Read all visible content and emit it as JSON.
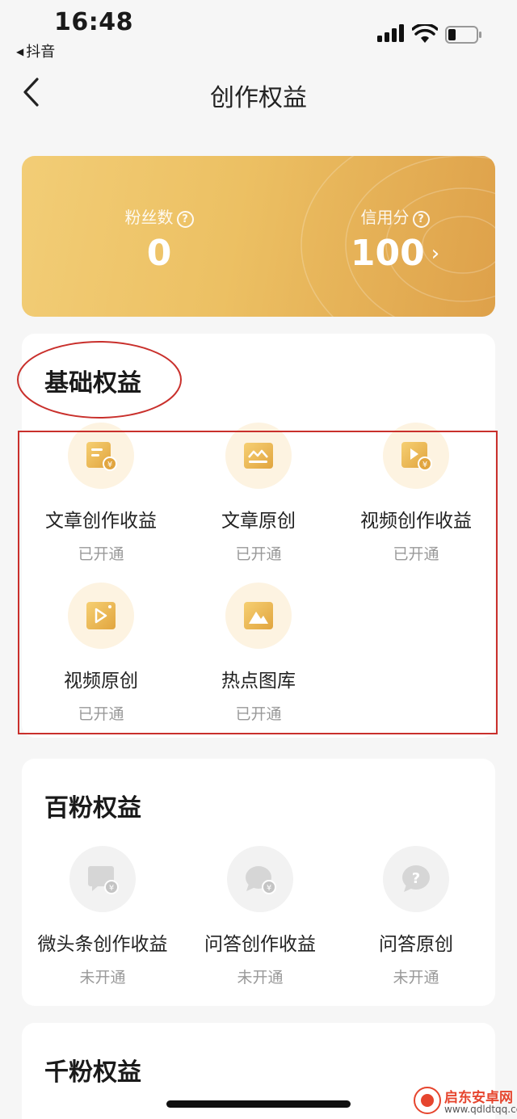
{
  "status": {
    "time": "16:48",
    "back_app": "抖音",
    "back_arrow": "◀"
  },
  "nav": {
    "title": "创作权益"
  },
  "stats": {
    "fans_label": "粉丝数",
    "fans_value": "0",
    "credit_label": "信用分",
    "credit_value": "100",
    "help_glyph": "?",
    "arrow_glyph": "›"
  },
  "sections": {
    "basic": {
      "title": "基础权益",
      "items": [
        {
          "name": "文章创作收益",
          "status": "已开通",
          "icon": "article-income-icon"
        },
        {
          "name": "文章原创",
          "status": "已开通",
          "icon": "article-original-icon"
        },
        {
          "name": "视频创作收益",
          "status": "已开通",
          "icon": "video-income-icon"
        },
        {
          "name": "视频原创",
          "status": "已开通",
          "icon": "video-original-icon"
        },
        {
          "name": "热点图库",
          "status": "已开通",
          "icon": "hot-gallery-icon"
        }
      ]
    },
    "hundred": {
      "title": "百粉权益",
      "items": [
        {
          "name": "微头条创作收益",
          "status": "未开通",
          "icon": "micro-headline-income-icon"
        },
        {
          "name": "问答创作收益",
          "status": "未开通",
          "icon": "qa-income-icon"
        },
        {
          "name": "问答原创",
          "status": "未开通",
          "icon": "qa-original-icon"
        }
      ]
    },
    "thousand": {
      "title": "千粉权益"
    }
  },
  "watermark": {
    "title": "启东安卓网",
    "url": "www.qdldtqq.com"
  },
  "colors": {
    "gold": "#ecc063",
    "annotation_red": "#c9302c"
  }
}
